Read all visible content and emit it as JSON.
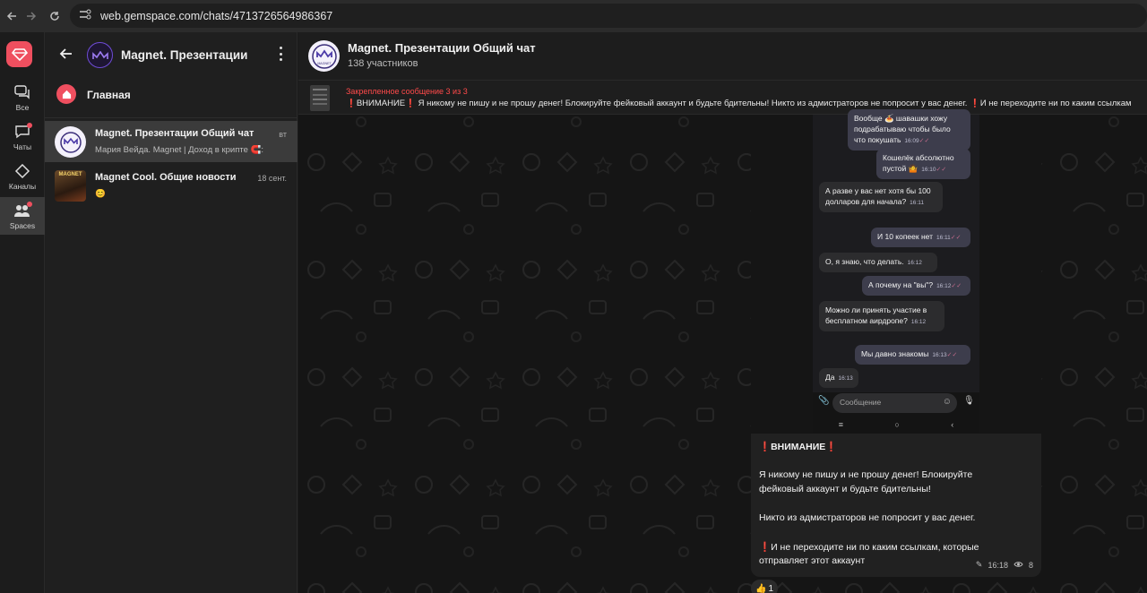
{
  "browser": {
    "url": "web.gemspace.com/chats/4713726564986367",
    "back_icon": "arrow-left-icon",
    "forward_icon": "arrow-right-icon",
    "reload_icon": "reload-icon",
    "site_info_icon": "site-info-icon"
  },
  "rail": {
    "items": [
      {
        "label": "Все",
        "icon": "chats-icon",
        "badge": false
      },
      {
        "label": "Чаты",
        "icon": "chat-icon",
        "badge": true
      },
      {
        "label": "Каналы",
        "icon": "channel-icon",
        "badge": false
      },
      {
        "label": "Spaces",
        "icon": "people-icon",
        "badge": true
      }
    ],
    "active": "Spaces"
  },
  "sidebar": {
    "title": "Magnet. Презентации",
    "home_label": "Главная",
    "chats": [
      {
        "title": "Magnet. Презентации Общий чат",
        "time": "вт",
        "preview": "Мария Вейда. Magnet | Доход в крипте 🧲:",
        "active": true
      },
      {
        "title": "Magnet Cool. Общие новости",
        "time": "18 сент.",
        "preview": "😊",
        "active": false
      }
    ]
  },
  "chat": {
    "title": "Magnet. Презентации Общий чат",
    "subtitle": "138 участников",
    "avatar_caption": "MAGNET",
    "pinned_label": "Закрепленное сообщение  3 из 3",
    "pinned_text": "❗ВНИМАНИЕ❗ Я никому не пишу и не прошу денег! Блокируйте фейковый аккаунт и будьте бдительны! Никто из адмистраторов не попросит у вас денег. ❗И не переходите ни по каким ссылкам"
  },
  "screenshot_messages": [
    {
      "text": "Вообще 🍝 шавашки хожу подрабатываю чтобы было что покушать",
      "time": "16:09",
      "out": true
    },
    {
      "text": "Кошелёк абсолютно пустой 🤷",
      "time": "16:10",
      "out": true
    },
    {
      "text": "А разве у вас нет хотя бы 100 долларов для начала?",
      "time": "16:11",
      "out": false
    },
    {
      "text": "И 10 копеек нет",
      "time": "16:11",
      "out": true
    },
    {
      "text": "О, я знаю, что делать.",
      "time": "16:12",
      "out": false
    },
    {
      "text": "А почему на \"вы\"?",
      "time": "16:12",
      "out": true
    },
    {
      "text": "Можно ли принять участие в бесплатном аирдропе?",
      "time": "16:12",
      "out": false
    },
    {
      "text": "Мы давно знакомы",
      "time": "16:13",
      "out": true
    },
    {
      "text": "Да",
      "time": "16:13",
      "out": false
    }
  ],
  "screenshot_input_placeholder": "Сообщение",
  "message": {
    "title": "ВНИМАНИЕ",
    "line1": "Я никому не пишу и не прошу денег! Блокируйте",
    "line2": "фейковый аккаунт и будьте бдительны!",
    "line3": "Никто из адмистраторов не попросит у вас денег.",
    "line4": "И не переходите ни по каким ссылкам, которые",
    "line5": "отправляет этот аккаунт",
    "time": "16:18",
    "views": "8",
    "reaction_emoji": "👍",
    "reaction_count": "1"
  },
  "colors": {
    "accent": "#ef4f5f",
    "pinned_label": "#ff4a4a",
    "warning": "#e53935"
  }
}
